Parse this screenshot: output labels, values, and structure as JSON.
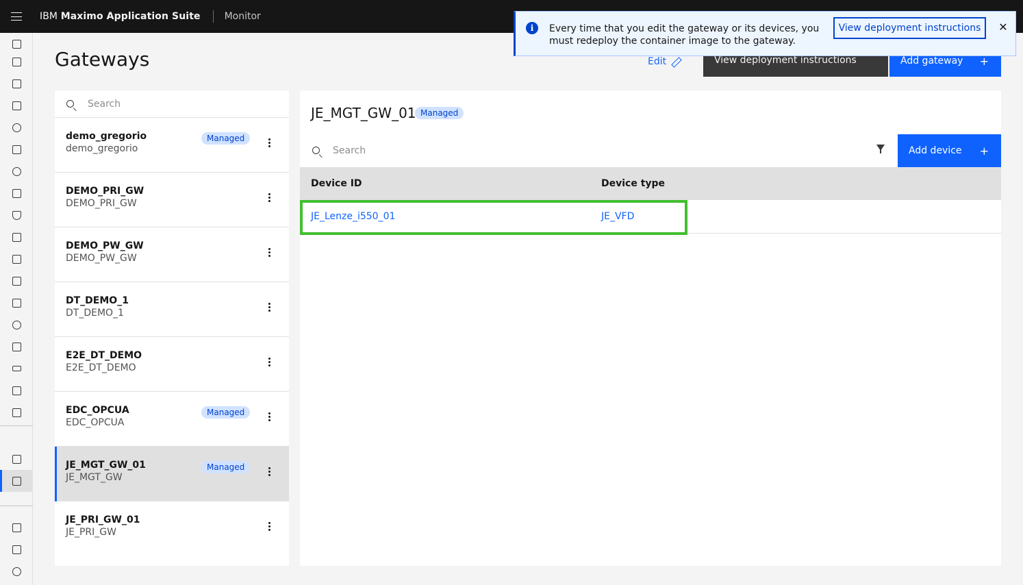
{
  "header": {
    "brand_prefix": "IBM",
    "brand_name": "Maximo Application Suite",
    "app_name": "Monitor"
  },
  "sidebar": {
    "icons": [
      "search-doc-icon",
      "report-icon",
      "line-chart-icon",
      "terminal-icon",
      "network-icon",
      "toolbox-icon",
      "hierarchy-icon",
      "calendar-icon",
      "shield-icon",
      "document-icon",
      "clipboard-icon",
      "lock-icon",
      "cart-icon",
      "exchange-icon",
      "people-icon",
      "sliders-icon",
      "checklist-icon",
      "list-icon",
      "dashboard-icon",
      "gateway-icon",
      "devices-icon",
      "security-icon",
      "settings-icon"
    ],
    "active_icon": "gateway-icon"
  },
  "page": {
    "title": "Gateways",
    "edit_label": "Edit",
    "view_instructions_label": "View deployment instructions",
    "add_gateway_label": "Add gateway"
  },
  "gateway_list": {
    "search_placeholder": "Search",
    "items": [
      {
        "name": "demo_gregorio",
        "sub": "demo_gregorio",
        "tag": "Managed"
      },
      {
        "name": "DEMO_PRI_GW",
        "sub": "DEMO_PRI_GW",
        "tag": ""
      },
      {
        "name": "DEMO_PW_GW",
        "sub": "DEMO_PW_GW",
        "tag": ""
      },
      {
        "name": "DT_DEMO_1",
        "sub": "DT_DEMO_1",
        "tag": ""
      },
      {
        "name": "E2E_DT_DEMO",
        "sub": "E2E_DT_DEMO",
        "tag": ""
      },
      {
        "name": "EDC_OPCUA",
        "sub": "EDC_OPCUA",
        "tag": "Managed"
      },
      {
        "name": "JE_MGT_GW_01",
        "sub": "JE_MGT_GW",
        "tag": "Managed"
      },
      {
        "name": "JE_PRI_GW_01",
        "sub": "JE_PRI_GW",
        "tag": ""
      }
    ],
    "selected": "JE_MGT_GW_01"
  },
  "detail": {
    "title": "JE_MGT_GW_01",
    "tag": "Managed",
    "search_placeholder": "Search",
    "add_device_label": "Add device",
    "columns": [
      "Device ID",
      "Device type"
    ],
    "rows": [
      {
        "device_id": "JE_Lenze_i550_01",
        "device_type": "JE_VFD"
      }
    ]
  },
  "notification": {
    "message": "Every time that you edit the gateway or its devices, you must redeploy the container image to the gateway.",
    "action_label": "View deployment instructions",
    "close_label": "✕",
    "info_glyph": "i"
  },
  "colors": {
    "brand_blue": "#0f62fe",
    "header_bg": "#161616",
    "tag_bg": "#d0e2ff",
    "highlight_green": "#42be30"
  }
}
